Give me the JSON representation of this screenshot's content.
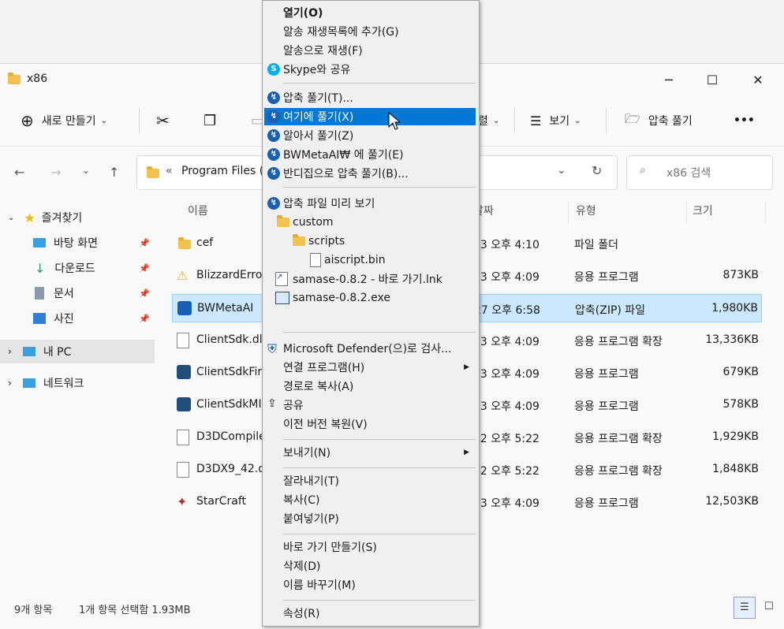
{
  "window": {
    "title": "x86",
    "minimize": "─",
    "maximize": "☐",
    "close": "✕"
  },
  "toolbar": {
    "new_label": "새로 만들기",
    "sort_label_fragment": "렬",
    "view_label": "보기",
    "extract_label": "압축 풀기",
    "more_label": "•••"
  },
  "address": {
    "path_prefix": "«",
    "path_text": "Program Files (",
    "search_placeholder": "x86 검색"
  },
  "sidebar": {
    "items": [
      {
        "label": "즐겨찾기",
        "icon": "star-icon"
      },
      {
        "label": "바탕 화면",
        "icon": "desktop-icon"
      },
      {
        "label": "다운로드",
        "icon": "download-icon"
      },
      {
        "label": "문서",
        "icon": "document-icon"
      },
      {
        "label": "사진",
        "icon": "pictures-icon"
      },
      {
        "label": "내 PC",
        "icon": "pc-icon"
      },
      {
        "label": "네트워크",
        "icon": "network-icon"
      }
    ]
  },
  "columns": {
    "name": "이름",
    "date": "날짜",
    "type": "유형",
    "size": "크기"
  },
  "files": [
    {
      "name": "cef",
      "date": "13 오후 4:10",
      "type": "파일 폴더",
      "size": "",
      "icon": "folder-icon"
    },
    {
      "name": "BlizzardError",
      "date": "13 오후 4:09",
      "type": "응용 프로그램",
      "size": "873KB",
      "icon": "warning-icon"
    },
    {
      "name": "BWMetaAI",
      "date": "27 오후 6:58",
      "type": "압축(ZIP) 파일",
      "size": "1,980KB",
      "icon": "zip-icon"
    },
    {
      "name": "ClientSdk.dl",
      "date": "13 오후 4:09",
      "type": "응용 프로그램 확장",
      "size": "13,336KB",
      "icon": "dll-icon"
    },
    {
      "name": "ClientSdkFir",
      "date": "13 오후 4:09",
      "type": "응용 프로그램",
      "size": "679KB",
      "icon": "app-icon"
    },
    {
      "name": "ClientSdkMI",
      "date": "13 오후 4:09",
      "type": "응용 프로그램",
      "size": "578KB",
      "icon": "app-icon"
    },
    {
      "name": "D3DCompile",
      "date": "22 오후 5:22",
      "type": "응용 프로그램 확장",
      "size": "1,929KB",
      "icon": "dll-icon"
    },
    {
      "name": "D3DX9_42.dl",
      "date": "22 오후 5:22",
      "type": "응용 프로그램 확장",
      "size": "1,848KB",
      "icon": "dll-icon"
    },
    {
      "name": "StarCraft",
      "date": "13 오후 4:09",
      "type": "응용 프로그램",
      "size": "12,503KB",
      "icon": "starcraft-icon"
    }
  ],
  "status": {
    "count": "9개 항목",
    "selection": "1개 항목 선택함 1.93MB"
  },
  "menu": {
    "open": "열기(O)",
    "add_playlist": "알송 재생목록에 추가(G)",
    "play_alsong": "알송으로 재생(F)",
    "skype_share": "Skype와 공유",
    "extract_to": "압축 풀기(T)...",
    "extract_here": "여기에 풀기(X)",
    "extract_smart": "알아서 풀기(Z)",
    "extract_folder": "BWMetaAI₩ 에 풀기(E)",
    "extract_bandizip": "반디집으로 압축 풀기(B)...",
    "preview": "압축 파일 미리 보기",
    "tree_custom": "custom",
    "tree_scripts": "scripts",
    "tree_file": "aiscript.bin",
    "tree_lnk": "samase-0.8.2 - 바로 가기.lnk",
    "tree_exe": "samase-0.8.2.exe",
    "defender": "Microsoft Defender(으)로 검사...",
    "open_with": "연결 프로그램(H)",
    "copy_path": "경로로 복사(A)",
    "share": "공유",
    "restore": "이전 버전 복원(V)",
    "send_to": "보내기(N)",
    "cut": "잘라내기(T)",
    "copy": "복사(C)",
    "paste": "붙여넣기(P)",
    "shortcut": "바로 가기 만들기(S)",
    "delete": "삭제(D)",
    "rename": "이름 바꾸기(M)",
    "properties": "속성(R)"
  }
}
